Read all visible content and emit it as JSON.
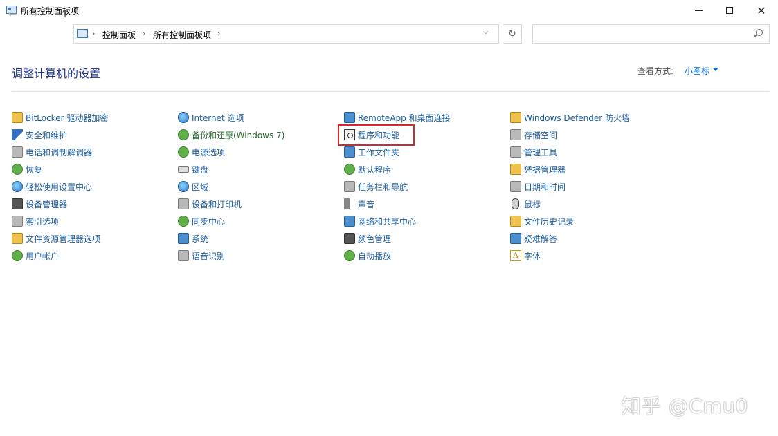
{
  "window": {
    "title": "所有控制面板项"
  },
  "address": {
    "crumbs": [
      "控制面板",
      "所有控制面板项"
    ],
    "sep": "›",
    "dropdown": "⌵",
    "refresh": "↻"
  },
  "search": {
    "placeholder": ""
  },
  "header": {
    "title": "调整计算机的设置",
    "view_by_label": "查看方式:",
    "view_by_value": "小图标"
  },
  "columns": [
    [
      {
        "label": "BitLocker 驱动器加密",
        "icon": "bitlocker-icon"
      },
      {
        "label": "安全和维护",
        "icon": "flag-icon"
      },
      {
        "label": "电话和调制解调器",
        "icon": "phone-modem-icon"
      },
      {
        "label": "恢复",
        "icon": "recovery-icon"
      },
      {
        "label": "轻松使用设置中心",
        "icon": "ease-of-access-icon"
      },
      {
        "label": "设备管理器",
        "icon": "device-manager-icon"
      },
      {
        "label": "索引选项",
        "icon": "indexing-icon"
      },
      {
        "label": "文件资源管理器选项",
        "icon": "folder-options-icon"
      },
      {
        "label": "用户帐户",
        "icon": "user-accounts-icon"
      }
    ],
    [
      {
        "label": "Internet 选项",
        "icon": "internet-options-icon"
      },
      {
        "label": "备份和还原(Windows 7)",
        "icon": "backup-icon"
      },
      {
        "label": "电源选项",
        "icon": "power-icon"
      },
      {
        "label": "键盘",
        "icon": "keyboard-icon"
      },
      {
        "label": "区域",
        "icon": "region-icon"
      },
      {
        "label": "设备和打印机",
        "icon": "printer-icon"
      },
      {
        "label": "同步中心",
        "icon": "sync-icon"
      },
      {
        "label": "系统",
        "icon": "system-icon"
      },
      {
        "label": "语音识别",
        "icon": "microphone-icon"
      }
    ],
    [
      {
        "label": "RemoteApp 和桌面连接",
        "icon": "remoteapp-icon"
      },
      {
        "label": "程序和功能",
        "icon": "programs-icon"
      },
      {
        "label": "工作文件夹",
        "icon": "work-folders-icon"
      },
      {
        "label": "默认程序",
        "icon": "default-programs-icon"
      },
      {
        "label": "任务栏和导航",
        "icon": "taskbar-icon"
      },
      {
        "label": "声音",
        "icon": "sound-icon"
      },
      {
        "label": "网络和共享中心",
        "icon": "network-icon"
      },
      {
        "label": "颜色管理",
        "icon": "color-management-icon"
      },
      {
        "label": "自动播放",
        "icon": "autoplay-icon"
      }
    ],
    [
      {
        "label": "Windows Defender 防火墙",
        "icon": "firewall-icon"
      },
      {
        "label": "存储空间",
        "icon": "storage-icon"
      },
      {
        "label": "管理工具",
        "icon": "admin-tools-icon"
      },
      {
        "label": "凭据管理器",
        "icon": "credential-icon"
      },
      {
        "label": "日期和时间",
        "icon": "calendar-icon"
      },
      {
        "label": "鼠标",
        "icon": "mouse-icon"
      },
      {
        "label": "文件历史记录",
        "icon": "file-history-icon"
      },
      {
        "label": "疑难解答",
        "icon": "troubleshoot-icon"
      },
      {
        "label": "字体",
        "icon": "font-icon"
      }
    ]
  ],
  "watermark": "知乎 @Cmu0",
  "highlight_color": "#d3282c",
  "link_color": "#1c5e9e"
}
